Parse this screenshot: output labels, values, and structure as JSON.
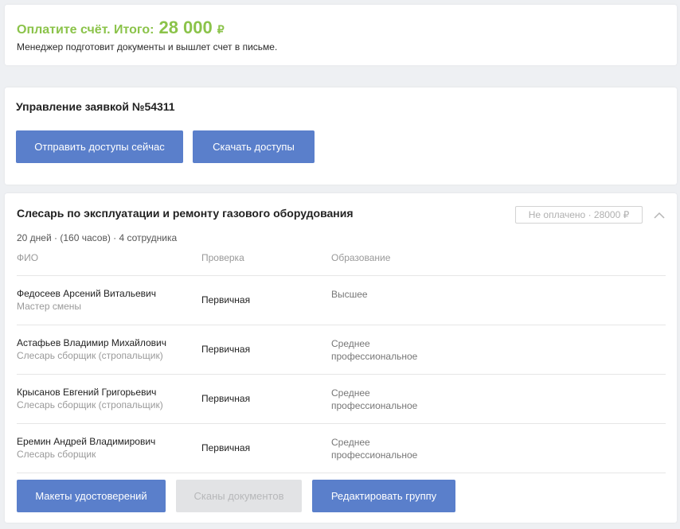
{
  "payment": {
    "title": "Оплатите счёт. Итого:",
    "amount": "28 000",
    "currency": "₽",
    "subtitle": "Менеджер подготовит документы и вышлет счет в письме."
  },
  "manage": {
    "title": "Управление заявкой №54311",
    "send_label": "Отправить доступы сейчас",
    "download_label": "Скачать доступы"
  },
  "group": {
    "title": "Слесарь по эксплуатации и ремонту газового оборудования",
    "status": "Не оплачено · 28000 ₽",
    "meta": "20 дней · (160 часов) · 4 сотрудника",
    "columns": [
      "ФИО",
      "Проверка",
      "Образование"
    ],
    "rows": [
      {
        "name": "Федосеев Арсений Витальевич",
        "role": "Мастер смены",
        "check": "Первичная",
        "edu": "Высшее"
      },
      {
        "name": "Астафьев Владимир Михайлович",
        "role": "Слесарь сборщик (стропальщик)",
        "check": "Первичная",
        "edu": "Среднее профессиональное"
      },
      {
        "name": "Крысанов Евгений Григорьевич",
        "role": "Слесарь сборщик (стропальщик)",
        "check": "Первичная",
        "edu": "Среднее профессиональное"
      },
      {
        "name": "Еремин Андрей Владимирович",
        "role": "Слесарь сборщик",
        "check": "Первичная",
        "edu": "Среднее профессиональное"
      }
    ],
    "layouts_label": "Макеты удостоверений",
    "scans_label": "Сканы документов",
    "edit_label": "Редактировать группу"
  },
  "colors": {
    "accent": "#5a7fcb",
    "success": "#8bc34a"
  },
  "icons": {
    "collapse": "chevron-up-icon"
  }
}
